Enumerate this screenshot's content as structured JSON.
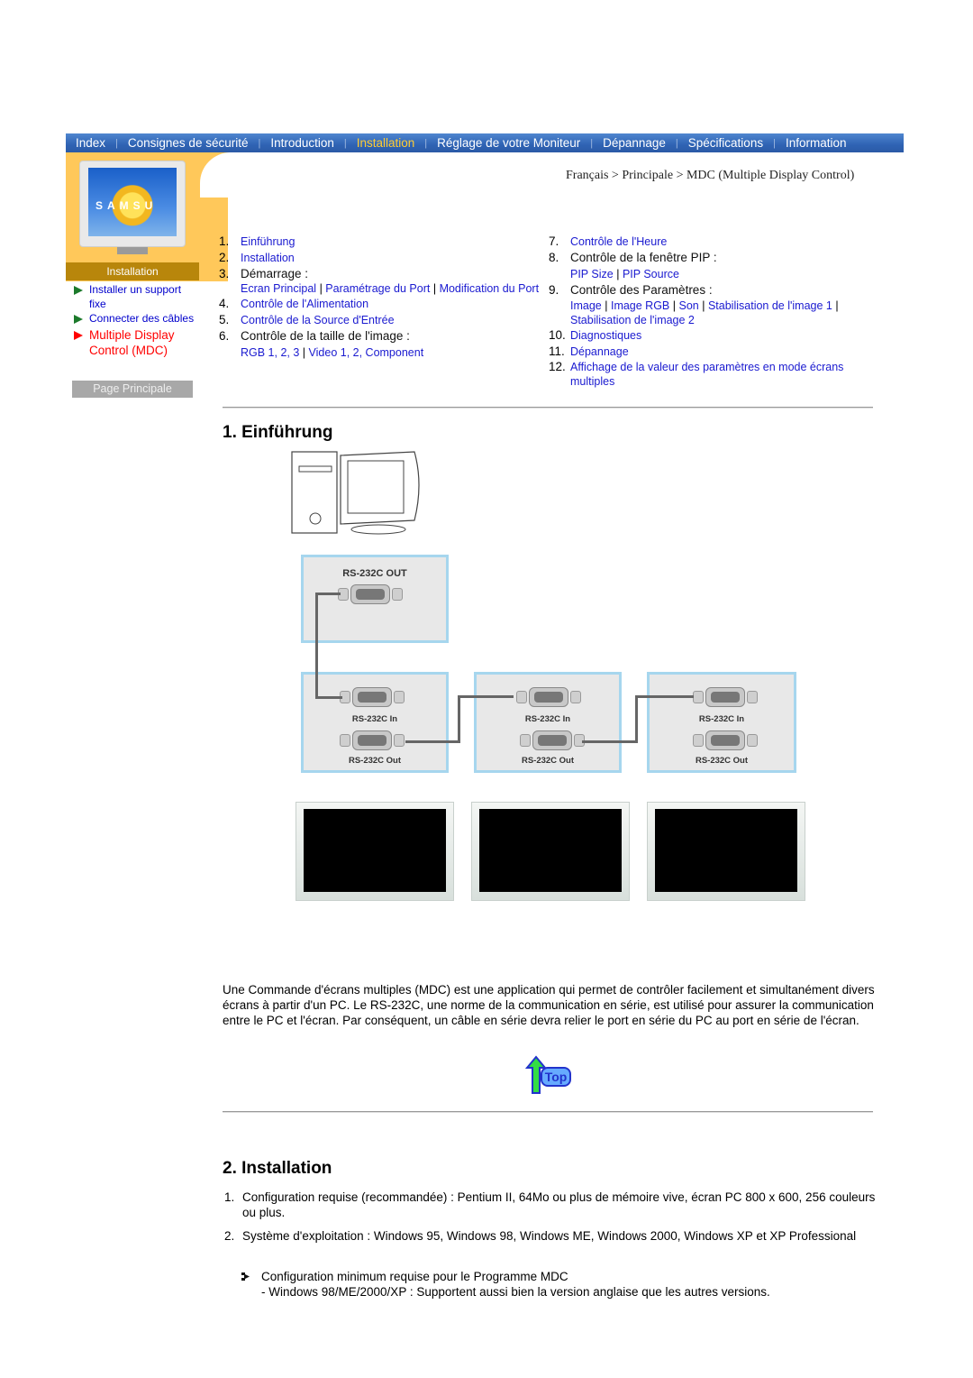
{
  "nav": {
    "items": [
      {
        "label": "Index",
        "active": false
      },
      {
        "label": "Consignes de sécurité",
        "active": false
      },
      {
        "label": "Introduction",
        "active": false
      },
      {
        "label": "Installation",
        "active": true
      },
      {
        "label": "Réglage de votre Moniteur",
        "active": false
      },
      {
        "label": "Dépannage",
        "active": false
      },
      {
        "label": "Spécifications",
        "active": false
      },
      {
        "label": "Information",
        "active": false
      }
    ],
    "separator": "|"
  },
  "sidebar": {
    "monitor_logo": "SAMSU",
    "title": "Installation",
    "links": [
      {
        "label": "Installer un support fixe",
        "current": false
      },
      {
        "label": "Connecter des câbles",
        "current": false
      },
      {
        "label": "Multiple Display Control (MDC)",
        "current": true
      }
    ],
    "home_button": "Page Principale"
  },
  "breadcrumb": "Français > Principale > MDC (Multiple Display Control)",
  "toc": {
    "left": [
      {
        "num": "1.",
        "label": "Einführung",
        "link": true
      },
      {
        "num": "2.",
        "label": "Installation",
        "link": true
      },
      {
        "num": "3.",
        "label": "Démarrage :",
        "link": false,
        "sub": [
          "Ecran Principal",
          "Paramétrage du Port",
          "Modification du Port"
        ]
      },
      {
        "num": "4.",
        "label": "Contrôle de l'Alimentation",
        "link": true
      },
      {
        "num": "5.",
        "label": "Contrôle de la Source d'Entrée",
        "link": true
      },
      {
        "num": "6.",
        "label": "Contrôle de la taille de l'image :",
        "link": false,
        "sub": [
          "RGB 1, 2, 3",
          "Video 1, 2, Component"
        ]
      }
    ],
    "right": [
      {
        "num": "7.",
        "label": "Contrôle de l'Heure",
        "link": true
      },
      {
        "num": "8.",
        "label": "Contrôle de la fenêtre PIP :",
        "link": false,
        "sub": [
          "PIP Size",
          "PIP Source"
        ]
      },
      {
        "num": "9.",
        "label": "Contrôle des Paramètres :",
        "link": false,
        "sub": [
          "Image",
          "Image RGB",
          "Son",
          "Stabilisation de l'image 1",
          "Stabilisation de l'image 2"
        ]
      },
      {
        "num": "10.",
        "label": "Diagnostiques",
        "link": true
      },
      {
        "num": "11.",
        "label": "Dépannage",
        "link": true
      },
      {
        "num": "12.",
        "label": "Affichage de la valeur des paramètres en mode écrans multiples",
        "link": true
      }
    ]
  },
  "section1": {
    "title": "1. Einführung",
    "diagram": {
      "pc_out_label": "RS-232C OUT",
      "in_label": "RS-232C In",
      "out_label": "RS-232C Out",
      "display_count": 3
    },
    "paragraph": "Une Commande d'écrans multiples (MDC) est une application qui permet de contrôler facilement et simultanément divers écrans à partir d'un PC. Le RS-232C, une norme de la communication en série, est utilisé pour assurer la communication entre le PC et l'écran. Par conséquent, un câble en série devra relier le port en série du PC au port en série de l'écran.",
    "top_button": "Top"
  },
  "section2": {
    "title": "2. Installation",
    "items": [
      {
        "num": "1.",
        "text": "Configuration requise (recommandée) : Pentium II, 64Mo ou plus de mémoire vive, écran PC 800 x 600, 256 couleurs ou plus."
      },
      {
        "num": "2.",
        "text": "Système d'exploitation : Windows 95, Windows 98, Windows ME, Windows 2000, Windows XP et XP Professional"
      }
    ],
    "note_title": "Configuration minimum requise pour le Programme MDC",
    "note_text": "- Windows 98/ME/2000/XP : Supportent aussi bien la version anglaise que les autres versions."
  },
  "colors": {
    "nav_blue": "#2f63b4",
    "nav_active": "#ffcc33",
    "sidebar_orange": "#ffc85a",
    "link_blue": "#1a1ad0",
    "current_red": "#ff0000"
  }
}
